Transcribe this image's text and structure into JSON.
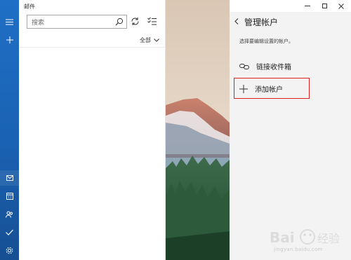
{
  "app": {
    "title": "邮件"
  },
  "search": {
    "placeholder": "搜索"
  },
  "list": {
    "filter_label": "全部"
  },
  "panel": {
    "title": "管理帐户",
    "description": "选择要编辑设置的帐户。",
    "link_inbox_label": "链接收件箱",
    "add_account_label": "添加帐户"
  },
  "watermark": {
    "url": "jingyan.baidu.com"
  },
  "colors": {
    "rail": "#1f6fc6",
    "highlight_box": "#e02020",
    "panel_bg": "#f3f3f3"
  },
  "icons": {
    "rail": [
      "hamburger-icon",
      "plus-icon",
      "mail-icon",
      "calendar-icon",
      "people-icon",
      "todo-icon",
      "settings-icon"
    ],
    "toolbar": [
      "search-icon",
      "sync-icon",
      "select-icon",
      "chevron-down-icon"
    ],
    "window": [
      "minimize-icon",
      "maximize-icon",
      "close-icon"
    ]
  }
}
